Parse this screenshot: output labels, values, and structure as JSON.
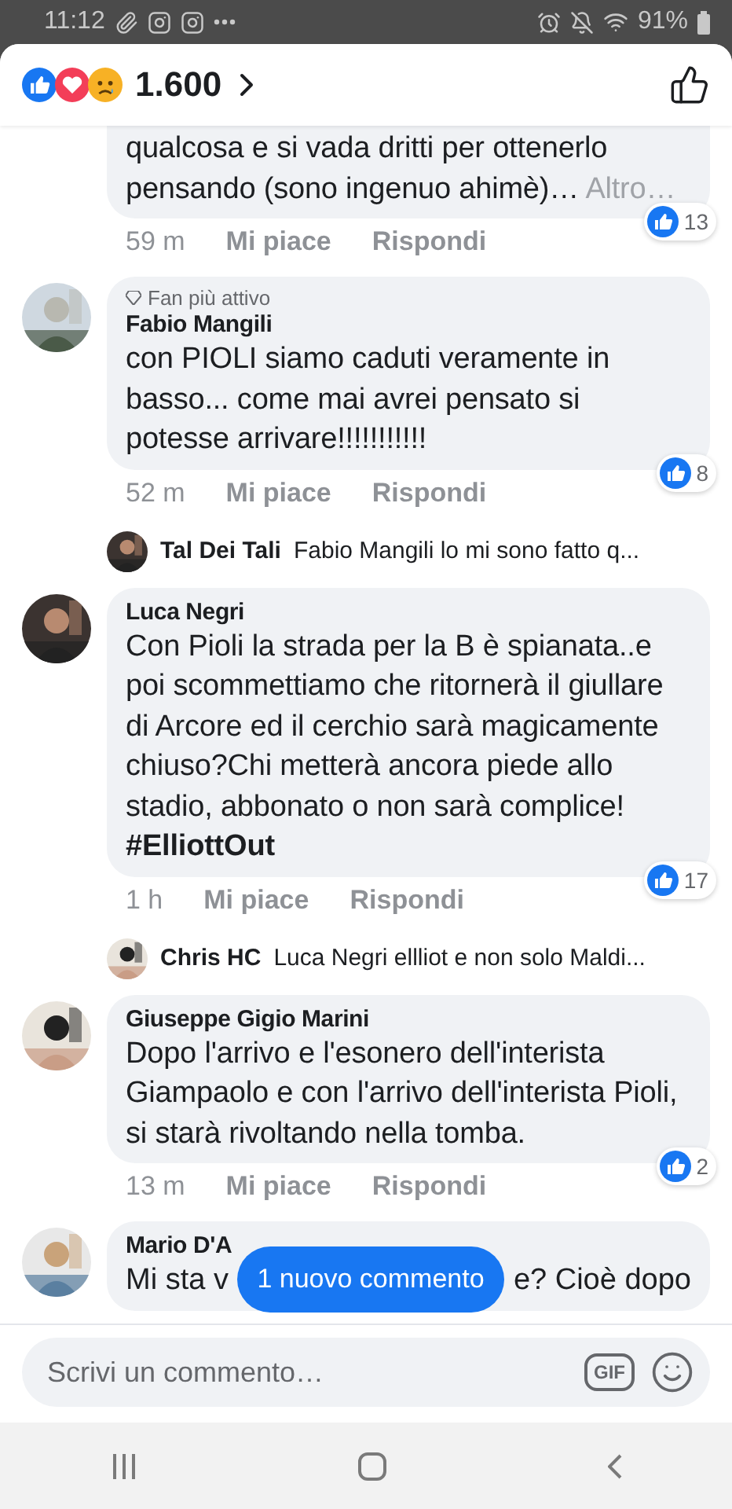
{
  "status_bar": {
    "time": "11:12",
    "battery": "91%"
  },
  "header": {
    "reaction_count": "1.600"
  },
  "comments": [
    {
      "text": "qualcosa e si vada dritti per ottenerlo pensando (sono ingenuo ahimè)…",
      "more": "Altro…",
      "time": "59 m",
      "like": "Mi piace",
      "reply": "Rispondi",
      "reactions": "13"
    },
    {
      "badge": "Fan più attivo",
      "author": "Fabio Mangili",
      "text": "con PIOLI siamo caduti veramente in basso... come mai avrei pensato si potesse arrivare!!!!!!!!!!!",
      "time": "52 m",
      "like": "Mi piace",
      "reply": "Rispondi",
      "reactions": "8",
      "reply_preview": {
        "author": "Tal Dei Tali",
        "text": "Fabio Mangili lo mi sono fatto q..."
      }
    },
    {
      "author": "Luca Negri",
      "text": "Con Pioli la strada per la B è spianata..e poi scommettiamo che ritornerà il giullare di Arcore ed il cerchio sarà magicamente chiuso?Chi metterà ancora piede allo stadio, abbonato o non sarà complice! **#ElliottOut**",
      "time": "1 h",
      "like": "Mi piace",
      "reply": "Rispondi",
      "reactions": "17",
      "reply_preview": {
        "author": "Chris HC",
        "text": "Luca Negri ellliot e non solo Maldi..."
      }
    },
    {
      "author": "Giuseppe Gigio Marini",
      "text": "Dopo l'arrivo e l'esonero dell'interista Giampaolo e con l'arrivo dell'interista Pioli, si starà rivoltando nella tomba.",
      "time": "13 m",
      "like": "Mi piace",
      "reply": "Rispondi",
      "reactions": "2"
    },
    {
      "author": "Mario D'A",
      "text_fragments": [
        "Mi sta v",
        "e? Cioè dopo"
      ]
    }
  ],
  "new_comments_pill": "1 nuovo commento",
  "composer": {
    "placeholder": "Scrivi un commento…",
    "gif_label": "GIF"
  }
}
